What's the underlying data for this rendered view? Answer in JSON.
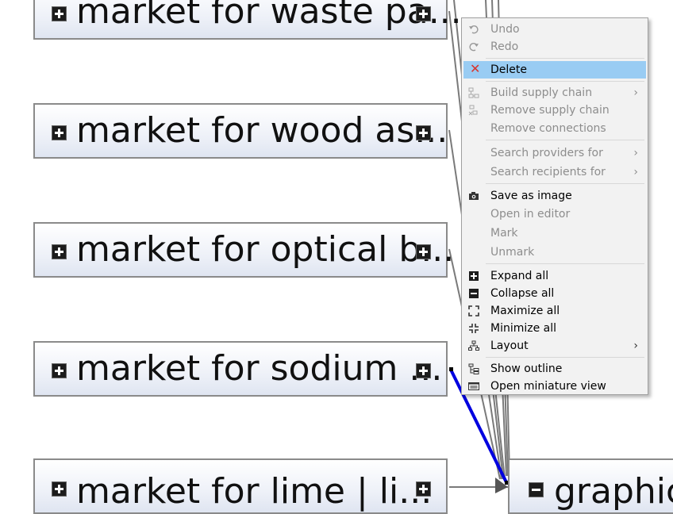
{
  "graph": {
    "nodes": [
      {
        "label": "market for waste pa..."
      },
      {
        "label": "market for wood as..."
      },
      {
        "label": "market for optical b..."
      },
      {
        "label": "market for sodium ..."
      },
      {
        "label": "market for lime | li..."
      }
    ],
    "target_node": {
      "label": "graphic"
    },
    "colors": {
      "highlight_link": "#0000e0",
      "link": "#7a7a7a"
    }
  },
  "context_menu": {
    "items": [
      {
        "label": "Undo",
        "icon": "undo-icon",
        "state": "disabled"
      },
      {
        "label": "Redo",
        "icon": "redo-icon",
        "state": "disabled"
      },
      {
        "label": "Delete",
        "icon": "delete-x-icon",
        "state": "selected"
      },
      {
        "label": "Build supply chain",
        "icon": "build-supply-chain-icon",
        "state": "disabled",
        "submenu": true
      },
      {
        "label": "Remove supply chain",
        "icon": "remove-supply-chain-icon",
        "state": "disabled"
      },
      {
        "label": "Remove connections",
        "icon": "",
        "state": "disabled"
      },
      {
        "label": "Search providers for",
        "icon": "",
        "state": "disabled",
        "submenu": true
      },
      {
        "label": "Search recipients for",
        "icon": "",
        "state": "disabled",
        "submenu": true
      },
      {
        "label": "Save as image",
        "icon": "camera-icon",
        "state": "enabled"
      },
      {
        "label": "Open in editor",
        "icon": "",
        "state": "disabled"
      },
      {
        "label": "Mark",
        "icon": "",
        "state": "disabled"
      },
      {
        "label": "Unmark",
        "icon": "",
        "state": "disabled"
      },
      {
        "label": "Expand all",
        "icon": "expand-icon",
        "state": "enabled"
      },
      {
        "label": "Collapse all",
        "icon": "collapse-icon",
        "state": "enabled"
      },
      {
        "label": "Maximize all",
        "icon": "maximize-icon",
        "state": "enabled"
      },
      {
        "label": "Minimize all",
        "icon": "minimize-icon",
        "state": "enabled"
      },
      {
        "label": "Layout",
        "icon": "layout-tree-icon",
        "state": "enabled",
        "submenu": true
      },
      {
        "label": "Show outline",
        "icon": "outline-icon",
        "state": "enabled"
      },
      {
        "label": "Open miniature view",
        "icon": "miniature-view-icon",
        "state": "enabled"
      }
    ],
    "submenu_glyph": "›",
    "colors": {
      "selection": "#99ccf3",
      "disabled_text": "#8d8d8d",
      "delete_icon": "#d9342b"
    }
  }
}
